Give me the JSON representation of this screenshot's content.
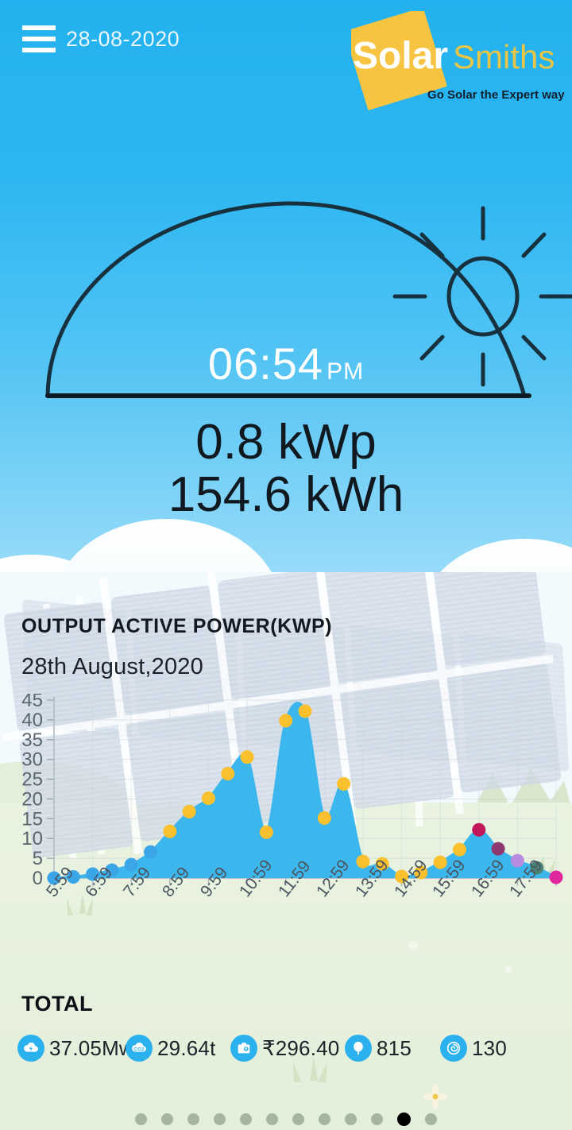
{
  "header": {
    "date": "28-08-2020",
    "menu_icon": "hamburger-menu-icon",
    "logo": {
      "word1": "Solar",
      "word2": "Smiths",
      "tagline": "Go Solar the Expert way!"
    }
  },
  "hero": {
    "time": "06:54",
    "ampm": "PM",
    "power_now": "0.8 kWp",
    "energy_today": "154.6 kWh",
    "sun_icon": "sun-icon",
    "arc_icon": "sun-path-arc"
  },
  "chart_panel": {
    "title": "OUTPUT ACTIVE POWER(KWP)",
    "subtitle": "28th August,2020"
  },
  "chart_data": {
    "type": "area",
    "title": "OUTPUT ACTIVE POWER(KWP)",
    "subtitle": "28th August,2020",
    "xlabel": "",
    "ylabel": "",
    "ylim": [
      0,
      45
    ],
    "yticks": [
      0,
      5,
      10,
      15,
      20,
      25,
      30,
      35,
      40,
      45
    ],
    "grid": true,
    "legend": false,
    "categories": [
      "5:59",
      "6:29",
      "6:59",
      "7:29",
      "7:59",
      "8:29",
      "8:59",
      "9:29",
      "9:59",
      "10:29",
      "10:59",
      "11:29",
      "11:59",
      "12:29",
      "12:59",
      "13:29",
      "13:59",
      "14:29",
      "14:59",
      "15:29",
      "15:59",
      "16:29",
      "16:59",
      "17:29",
      "17:59",
      "18:29"
    ],
    "xtick_labels": [
      "5:59",
      "6:59",
      "7:59",
      "8:59",
      "9:59",
      "10:59",
      "11:59",
      "12:59",
      "13:59",
      "14:59",
      "15:59",
      "16:59",
      "17:59"
    ],
    "values": [
      0.0,
      0.3,
      1.0,
      2.0,
      3.4,
      6.6,
      11.8,
      16.8,
      20.2,
      26.4,
      30.6,
      11.6,
      39.8,
      42.2,
      15.2,
      23.8,
      4.2,
      3.6,
      0.4,
      1.4,
      4.0,
      7.2,
      12.2,
      7.4,
      4.4,
      2.6,
      0.2
    ],
    "point_colors": [
      "#3aa6e8",
      "#3aa6e8",
      "#3aa6e8",
      "#3aa6e8",
      "#3aa6e8",
      "#3aa6e8",
      "#fbc02d",
      "#fbc02d",
      "#fbc02d",
      "#fbc02d",
      "#fbc02d",
      "#fbc02d",
      "#fbc02d",
      "#fbc02d",
      "#fbc02d",
      "#fbc02d",
      "#fbc02d",
      "#fbc02d",
      "#fbc02d",
      "#fbc02d",
      "#fbc02d",
      "#fbc02d",
      "#c2185b",
      "#8e3a6e",
      "#b78be0",
      "#4c8476",
      "#e0289c"
    ],
    "area_fill": "#3cb7ee",
    "line_color": "#3cb7ee"
  },
  "totals": {
    "label": "TOTAL",
    "items": [
      {
        "icon": "cloud-energy-icon",
        "value": "37.05Mwh"
      },
      {
        "icon": "cloud-co2-icon",
        "value": "29.64t"
      },
      {
        "icon": "money-savings-icon",
        "value": "₹296.40"
      },
      {
        "icon": "tree-icon",
        "value": "815"
      },
      {
        "icon": "coal-saved-icon",
        "value": "130"
      }
    ]
  },
  "pager": {
    "count": 12,
    "active_index": 10
  },
  "colors": {
    "sky": "#2bb6f0",
    "accent_yellow": "#f6c445",
    "chart_blue": "#3cb7ee",
    "icon_blue": "#2bb2ee"
  }
}
